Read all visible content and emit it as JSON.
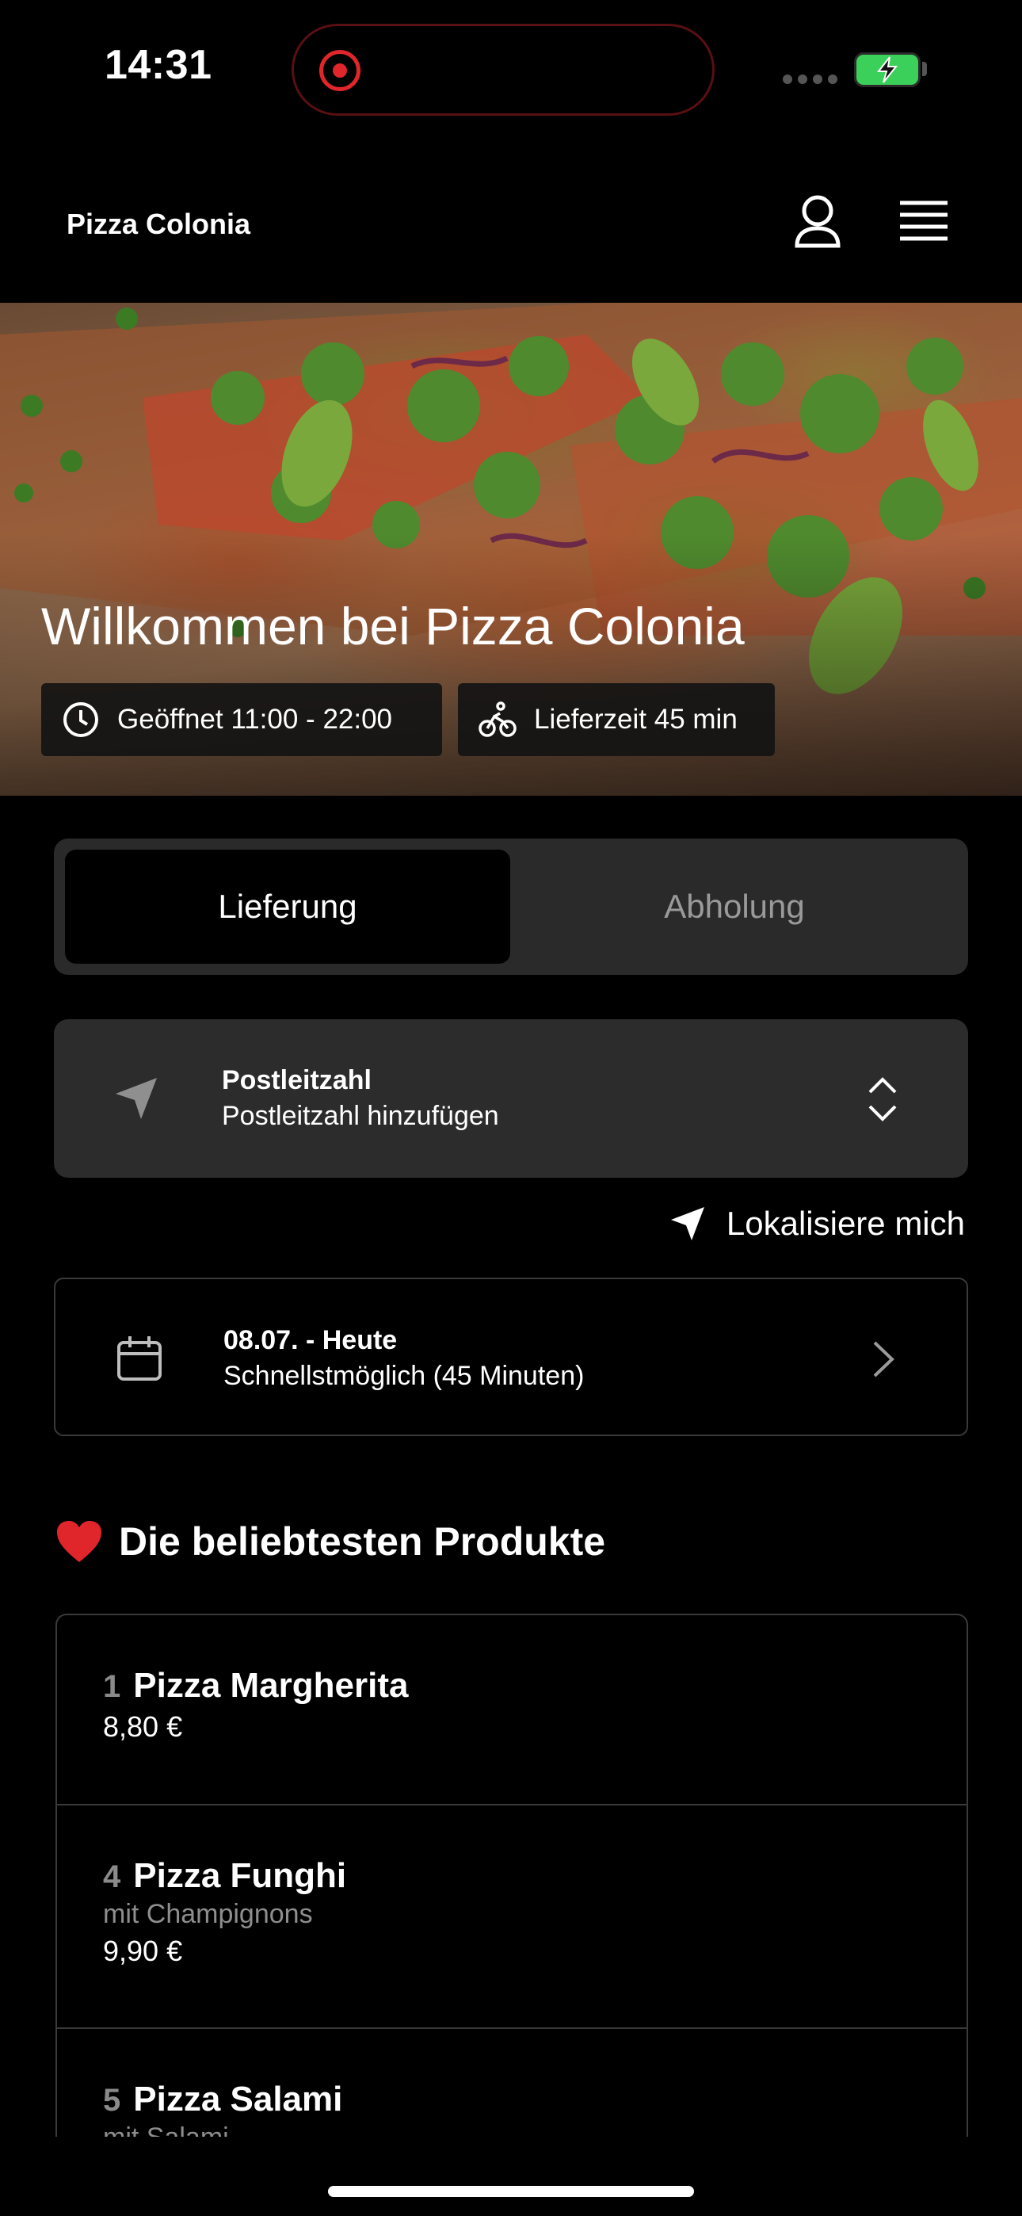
{
  "status_bar": {
    "time": "14:31"
  },
  "header": {
    "brand": "Pizza Colonia"
  },
  "hero": {
    "title": "Willkommen bei Pizza Colonia",
    "opening_hours": "Geöffnet 11:00 - 22:00",
    "delivery_time": "Lieferzeit 45 min"
  },
  "mode_toggle": {
    "delivery": "Lieferung",
    "pickup": "Abholung",
    "selected": "Lieferung"
  },
  "postcode": {
    "label": "Postleitzahl",
    "placeholder": "Postleitzahl hinzufügen"
  },
  "locate": {
    "label": "Lokalisiere mich"
  },
  "schedule": {
    "date": "08.07. - Heute",
    "time": "Schnellstmöglich (45 Minuten)"
  },
  "popular": {
    "title": "Die beliebtesten Produkte",
    "items": [
      {
        "number": "1",
        "name": "Pizza Margherita",
        "description": "",
        "price": "8,80 €"
      },
      {
        "number": "4",
        "name": "Pizza Funghi",
        "description": "mit Champignons",
        "price": "9,90 €"
      },
      {
        "number": "5",
        "name": "Pizza Salami",
        "description": "mit Salami",
        "price": ""
      }
    ]
  },
  "colors": {
    "background": "#000000",
    "card": "#2c2c2c",
    "accent_red": "#e0262b",
    "battery": "#3bd05a"
  }
}
